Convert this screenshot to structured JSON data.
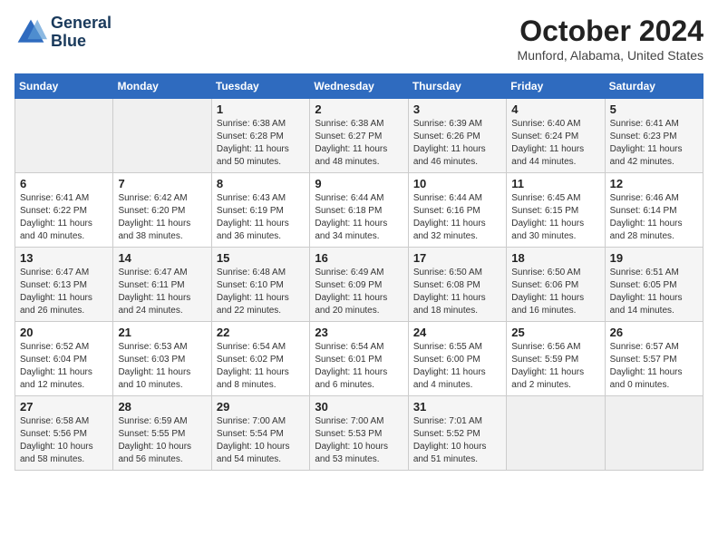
{
  "header": {
    "logo_line1": "General",
    "logo_line2": "Blue",
    "title": "October 2024",
    "subtitle": "Munford, Alabama, United States"
  },
  "weekdays": [
    "Sunday",
    "Monday",
    "Tuesday",
    "Wednesday",
    "Thursday",
    "Friday",
    "Saturday"
  ],
  "weeks": [
    [
      {
        "day": "",
        "sunrise": "",
        "sunset": "",
        "daylight": ""
      },
      {
        "day": "",
        "sunrise": "",
        "sunset": "",
        "daylight": ""
      },
      {
        "day": "1",
        "sunrise": "Sunrise: 6:38 AM",
        "sunset": "Sunset: 6:28 PM",
        "daylight": "Daylight: 11 hours and 50 minutes."
      },
      {
        "day": "2",
        "sunrise": "Sunrise: 6:38 AM",
        "sunset": "Sunset: 6:27 PM",
        "daylight": "Daylight: 11 hours and 48 minutes."
      },
      {
        "day": "3",
        "sunrise": "Sunrise: 6:39 AM",
        "sunset": "Sunset: 6:26 PM",
        "daylight": "Daylight: 11 hours and 46 minutes."
      },
      {
        "day": "4",
        "sunrise": "Sunrise: 6:40 AM",
        "sunset": "Sunset: 6:24 PM",
        "daylight": "Daylight: 11 hours and 44 minutes."
      },
      {
        "day": "5",
        "sunrise": "Sunrise: 6:41 AM",
        "sunset": "Sunset: 6:23 PM",
        "daylight": "Daylight: 11 hours and 42 minutes."
      }
    ],
    [
      {
        "day": "6",
        "sunrise": "Sunrise: 6:41 AM",
        "sunset": "Sunset: 6:22 PM",
        "daylight": "Daylight: 11 hours and 40 minutes."
      },
      {
        "day": "7",
        "sunrise": "Sunrise: 6:42 AM",
        "sunset": "Sunset: 6:20 PM",
        "daylight": "Daylight: 11 hours and 38 minutes."
      },
      {
        "day": "8",
        "sunrise": "Sunrise: 6:43 AM",
        "sunset": "Sunset: 6:19 PM",
        "daylight": "Daylight: 11 hours and 36 minutes."
      },
      {
        "day": "9",
        "sunrise": "Sunrise: 6:44 AM",
        "sunset": "Sunset: 6:18 PM",
        "daylight": "Daylight: 11 hours and 34 minutes."
      },
      {
        "day": "10",
        "sunrise": "Sunrise: 6:44 AM",
        "sunset": "Sunset: 6:16 PM",
        "daylight": "Daylight: 11 hours and 32 minutes."
      },
      {
        "day": "11",
        "sunrise": "Sunrise: 6:45 AM",
        "sunset": "Sunset: 6:15 PM",
        "daylight": "Daylight: 11 hours and 30 minutes."
      },
      {
        "day": "12",
        "sunrise": "Sunrise: 6:46 AM",
        "sunset": "Sunset: 6:14 PM",
        "daylight": "Daylight: 11 hours and 28 minutes."
      }
    ],
    [
      {
        "day": "13",
        "sunrise": "Sunrise: 6:47 AM",
        "sunset": "Sunset: 6:13 PM",
        "daylight": "Daylight: 11 hours and 26 minutes."
      },
      {
        "day": "14",
        "sunrise": "Sunrise: 6:47 AM",
        "sunset": "Sunset: 6:11 PM",
        "daylight": "Daylight: 11 hours and 24 minutes."
      },
      {
        "day": "15",
        "sunrise": "Sunrise: 6:48 AM",
        "sunset": "Sunset: 6:10 PM",
        "daylight": "Daylight: 11 hours and 22 minutes."
      },
      {
        "day": "16",
        "sunrise": "Sunrise: 6:49 AM",
        "sunset": "Sunset: 6:09 PM",
        "daylight": "Daylight: 11 hours and 20 minutes."
      },
      {
        "day": "17",
        "sunrise": "Sunrise: 6:50 AM",
        "sunset": "Sunset: 6:08 PM",
        "daylight": "Daylight: 11 hours and 18 minutes."
      },
      {
        "day": "18",
        "sunrise": "Sunrise: 6:50 AM",
        "sunset": "Sunset: 6:06 PM",
        "daylight": "Daylight: 11 hours and 16 minutes."
      },
      {
        "day": "19",
        "sunrise": "Sunrise: 6:51 AM",
        "sunset": "Sunset: 6:05 PM",
        "daylight": "Daylight: 11 hours and 14 minutes."
      }
    ],
    [
      {
        "day": "20",
        "sunrise": "Sunrise: 6:52 AM",
        "sunset": "Sunset: 6:04 PM",
        "daylight": "Daylight: 11 hours and 12 minutes."
      },
      {
        "day": "21",
        "sunrise": "Sunrise: 6:53 AM",
        "sunset": "Sunset: 6:03 PM",
        "daylight": "Daylight: 11 hours and 10 minutes."
      },
      {
        "day": "22",
        "sunrise": "Sunrise: 6:54 AM",
        "sunset": "Sunset: 6:02 PM",
        "daylight": "Daylight: 11 hours and 8 minutes."
      },
      {
        "day": "23",
        "sunrise": "Sunrise: 6:54 AM",
        "sunset": "Sunset: 6:01 PM",
        "daylight": "Daylight: 11 hours and 6 minutes."
      },
      {
        "day": "24",
        "sunrise": "Sunrise: 6:55 AM",
        "sunset": "Sunset: 6:00 PM",
        "daylight": "Daylight: 11 hours and 4 minutes."
      },
      {
        "day": "25",
        "sunrise": "Sunrise: 6:56 AM",
        "sunset": "Sunset: 5:59 PM",
        "daylight": "Daylight: 11 hours and 2 minutes."
      },
      {
        "day": "26",
        "sunrise": "Sunrise: 6:57 AM",
        "sunset": "Sunset: 5:57 PM",
        "daylight": "Daylight: 11 hours and 0 minutes."
      }
    ],
    [
      {
        "day": "27",
        "sunrise": "Sunrise: 6:58 AM",
        "sunset": "Sunset: 5:56 PM",
        "daylight": "Daylight: 10 hours and 58 minutes."
      },
      {
        "day": "28",
        "sunrise": "Sunrise: 6:59 AM",
        "sunset": "Sunset: 5:55 PM",
        "daylight": "Daylight: 10 hours and 56 minutes."
      },
      {
        "day": "29",
        "sunrise": "Sunrise: 7:00 AM",
        "sunset": "Sunset: 5:54 PM",
        "daylight": "Daylight: 10 hours and 54 minutes."
      },
      {
        "day": "30",
        "sunrise": "Sunrise: 7:00 AM",
        "sunset": "Sunset: 5:53 PM",
        "daylight": "Daylight: 10 hours and 53 minutes."
      },
      {
        "day": "31",
        "sunrise": "Sunrise: 7:01 AM",
        "sunset": "Sunset: 5:52 PM",
        "daylight": "Daylight: 10 hours and 51 minutes."
      },
      {
        "day": "",
        "sunrise": "",
        "sunset": "",
        "daylight": ""
      },
      {
        "day": "",
        "sunrise": "",
        "sunset": "",
        "daylight": ""
      }
    ]
  ]
}
